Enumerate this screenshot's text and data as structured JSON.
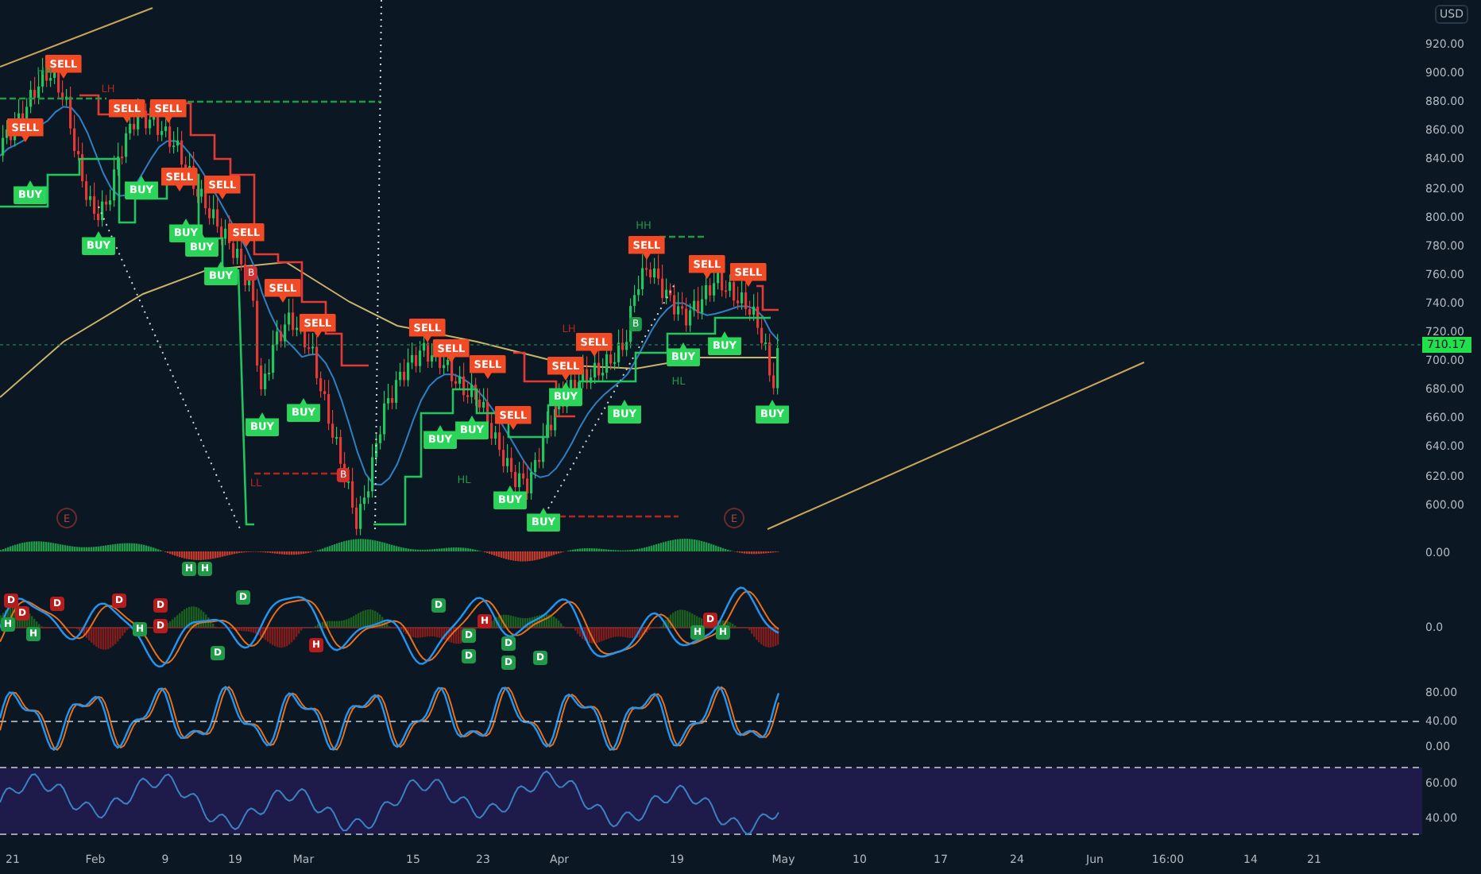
{
  "price_axis": {
    "currency": "USD",
    "ticks": [
      "920.00",
      "900.00",
      "880.00",
      "860.00",
      "840.00",
      "820.00",
      "800.00",
      "780.00",
      "760.00",
      "740.00",
      "720.00",
      "700.00",
      "680.00",
      "660.00",
      "640.00",
      "620.00",
      "600.00"
    ],
    "last_price": "710.17"
  },
  "signals": [
    {
      "kind": "sell",
      "label": "SELL"
    },
    {
      "kind": "sell",
      "label": "SELL"
    },
    {
      "kind": "sell",
      "label": "SELL"
    },
    {
      "kind": "sell",
      "label": "SELL"
    },
    {
      "kind": "sell",
      "label": "SELL"
    },
    {
      "kind": "sell",
      "label": "SELL"
    },
    {
      "kind": "sell",
      "label": "SELL"
    },
    {
      "kind": "sell",
      "label": "SELL"
    },
    {
      "kind": "sell",
      "label": "SELL"
    },
    {
      "kind": "sell",
      "label": "SELL"
    },
    {
      "kind": "sell",
      "label": "SELL"
    },
    {
      "kind": "sell",
      "label": "SELL"
    },
    {
      "kind": "sell",
      "label": "SELL"
    },
    {
      "kind": "sell",
      "label": "SELL"
    },
    {
      "kind": "sell",
      "label": "SELL"
    },
    {
      "kind": "sell",
      "label": "SELL"
    },
    {
      "kind": "sell",
      "label": "SELL"
    },
    {
      "kind": "sell",
      "label": "SELL"
    },
    {
      "kind": "buy",
      "label": "BUY"
    },
    {
      "kind": "buy",
      "label": "BUY"
    },
    {
      "kind": "buy",
      "label": "BUY"
    },
    {
      "kind": "buy",
      "label": "BUY"
    },
    {
      "kind": "buy",
      "label": "BUY"
    },
    {
      "kind": "buy",
      "label": "BUY"
    },
    {
      "kind": "buy",
      "label": "BUY"
    },
    {
      "kind": "buy",
      "label": "BUY"
    },
    {
      "kind": "buy",
      "label": "BUY"
    },
    {
      "kind": "buy",
      "label": "BUY"
    },
    {
      "kind": "buy",
      "label": "BUY"
    },
    {
      "kind": "buy",
      "label": "BUY"
    },
    {
      "kind": "buy",
      "label": "BUY"
    },
    {
      "kind": "buy",
      "label": "BUY"
    },
    {
      "kind": "buy",
      "label": "BUY"
    },
    {
      "kind": "buy",
      "label": "BUY"
    },
    {
      "kind": "buy",
      "label": "BUY"
    }
  ],
  "structure_labels": [
    {
      "text": "HH",
      "color": "#1f9a48"
    },
    {
      "text": "HH",
      "color": "#1f9a48"
    },
    {
      "text": "LH",
      "color": "#b3261e"
    },
    {
      "text": "LH",
      "color": "#b3261e"
    },
    {
      "text": "LL",
      "color": "#b3261e"
    },
    {
      "text": "HL",
      "color": "#1f9a48"
    },
    {
      "text": "HL",
      "color": "#1f9a48"
    }
  ],
  "break_markers": [
    {
      "text": "B",
      "color": "#d32f2f"
    },
    {
      "text": "B",
      "color": "#1f9a48"
    },
    {
      "text": "B",
      "color": "#d32f2f"
    }
  ],
  "event_markers": [
    "E",
    "E"
  ],
  "indicator_badges": [
    {
      "text": "H",
      "color": "#1f9a48"
    },
    {
      "text": "D",
      "color": "#b71c1c"
    },
    {
      "text": "D",
      "color": "#b71c1c"
    },
    {
      "text": "H",
      "color": "#1f9a48"
    },
    {
      "text": "D",
      "color": "#b71c1c"
    },
    {
      "text": "D",
      "color": "#b71c1c"
    },
    {
      "text": "H",
      "color": "#1f9a48"
    },
    {
      "text": "D",
      "color": "#b71c1c"
    },
    {
      "text": "D",
      "color": "#b71c1c"
    },
    {
      "text": "H",
      "color": "#1f9a48"
    },
    {
      "text": "H",
      "color": "#1f9a48"
    },
    {
      "text": "D",
      "color": "#1f9a48"
    },
    {
      "text": "D",
      "color": "#1f9a48"
    },
    {
      "text": "H",
      "color": "#b71c1c"
    },
    {
      "text": "D",
      "color": "#1f9a48"
    },
    {
      "text": "D",
      "color": "#1f9a48"
    },
    {
      "text": "D",
      "color": "#1f9a48"
    },
    {
      "text": "H",
      "color": "#b71c1c"
    },
    {
      "text": "D",
      "color": "#1f9a48"
    },
    {
      "text": "D",
      "color": "#1f9a48"
    },
    {
      "text": "D",
      "color": "#1f9a48"
    },
    {
      "text": "H",
      "color": "#1f9a48"
    },
    {
      "text": "D",
      "color": "#b71c1c"
    },
    {
      "text": "H",
      "color": "#1f9a48"
    }
  ],
  "indicator_axis": [
    "0.00",
    "0.0",
    "80.00",
    "40.00",
    "0.00",
    "60.00",
    "40.00"
  ],
  "time_axis": [
    "21",
    "Feb",
    "9",
    "19",
    "Mar",
    "15",
    "23",
    "Apr",
    "19",
    "May",
    "10",
    "17",
    "24",
    "Jun",
    "16:00",
    "14",
    "21"
  ]
}
